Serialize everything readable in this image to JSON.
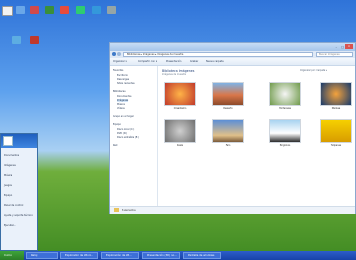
{
  "taskbar": {
    "start": "Inicio",
    "tasks": [
      "Reloj",
      "Explorador de Wind...",
      "Exploración de Wi...",
      "Presentación (3D) no...",
      "Pantalla de windows"
    ]
  },
  "start_menu": {
    "items": [
      "Documentos",
      "Imágenes",
      "Música",
      "Juegos",
      "Equipo",
      "Panel de control",
      "Ayuda y soporte técnico",
      "Ejecutar..."
    ]
  },
  "explorer": {
    "address": "Bibliotecas ▸ Imágenes ▸ Imágenes de muestra",
    "search_placeholder": "Buscar Imágenes",
    "toolbar": {
      "organize": "Organizar ▾",
      "share": "Compartir con ▾",
      "slideshow": "Presentación",
      "burn": "Grabar",
      "new_folder": "Nueva carpeta"
    },
    "nav": {
      "favorites": "Favoritos",
      "favorites_items": [
        "Escritorio",
        "Descargas",
        "Sitios recientes"
      ],
      "libraries": "Bibliotecas",
      "library_items": [
        "Documentos",
        "Imágenes",
        "Música",
        "Vídeos"
      ],
      "homegroup": "Grupo en el hogar",
      "computer": "Equipo",
      "computer_items": [
        "Disco local (C:)",
        "DVD (D:)",
        "Disco extraíble (E:)"
      ],
      "network": "Red"
    },
    "library_title": "Biblioteca Imágenes",
    "library_subtitle": "Imágenes de muestra",
    "arrange": "Organizar por: Carpeta ▾",
    "images": [
      "Crisantemo",
      "Desierto",
      "Hortensias",
      "Medusa",
      "Koala",
      "Faro",
      "Pingüinos",
      "Tulipanes"
    ],
    "status": "8 elementos"
  },
  "colors": {
    "desktop": "#2f73d8",
    "taskbar": "#1842a8",
    "accent": "#1f3d75"
  }
}
